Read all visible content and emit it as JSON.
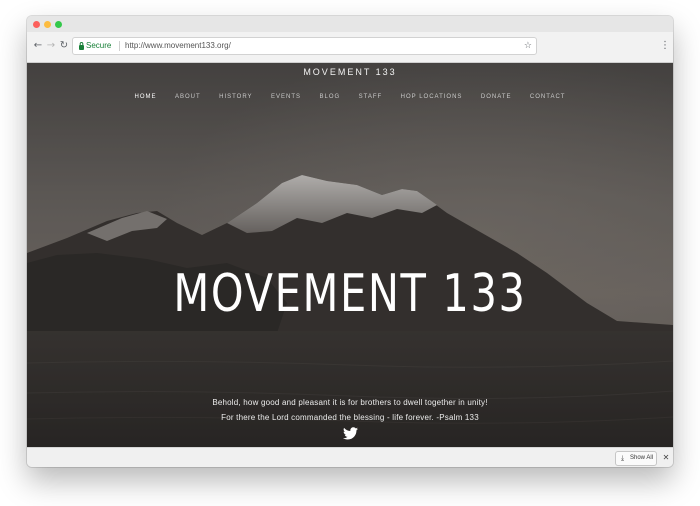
{
  "browser": {
    "security_label": "Secure",
    "url": "http://www.movement133.org/",
    "icons": {
      "back": "back-arrow-icon",
      "forward": "forward-arrow-icon",
      "reload": "reload-icon",
      "lock": "lock-icon",
      "bookmark": "star-icon",
      "menu": "menu-dots-icon"
    },
    "colors": {
      "close": "#fc605c",
      "minimize": "#fdbc40",
      "maximize": "#34c84a",
      "secure": "#188038"
    }
  },
  "site": {
    "title": "MOVEMENT 133",
    "nav": [
      {
        "label": "HOME",
        "active": true
      },
      {
        "label": "ABOUT",
        "active": false
      },
      {
        "label": "HISTORY",
        "active": false
      },
      {
        "label": "EVENTS",
        "active": false
      },
      {
        "label": "BLOG",
        "active": false
      },
      {
        "label": "STAFF",
        "active": false
      },
      {
        "label": "HOP LOCATIONS",
        "active": false
      },
      {
        "label": "DONATE",
        "active": false
      },
      {
        "label": "CONTACT",
        "active": false
      }
    ]
  },
  "hero": {
    "heading": "MOVEMENT 133",
    "verse_line1": "Behold, how good and pleasant it is for brothers to dwell together in unity!",
    "verse_line2": "For there the Lord commanded the blessing - life forever. -Psalm 133",
    "social_icon": "twitter-icon"
  },
  "download_bar": {
    "show_all_label": "Show All",
    "download_icon": "download-icon",
    "close_icon": "close-icon"
  }
}
